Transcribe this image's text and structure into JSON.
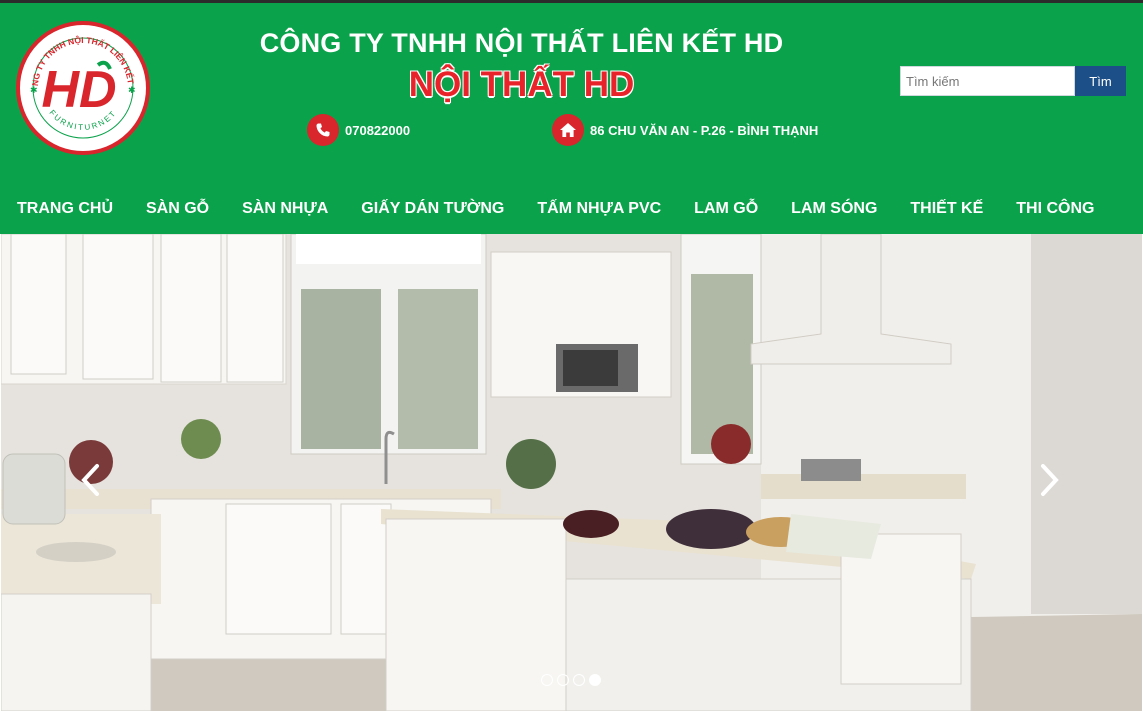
{
  "header": {
    "company_name": "CÔNG TY TNHH NỘI THẤT LIÊN KẾT HD",
    "brand_name": "NỘI THẤT HD",
    "phone": "070822000",
    "address": "86 CHU VĂN AN - P.26 - BÌNH THẠNH",
    "logo": {
      "initials": "HD",
      "ring_text_top": "CÔNG TY TNHH NỘI THẤT LIÊN KẾT HD",
      "ring_text_bottom": "FURNITURNET"
    }
  },
  "search": {
    "placeholder": "Tìm kiếm",
    "button_label": "Tìm"
  },
  "nav": {
    "items": [
      {
        "label": "TRANG CHỦ"
      },
      {
        "label": "SÀN GỖ"
      },
      {
        "label": "SÀN NHỰA"
      },
      {
        "label": "GIẤY DÁN TƯỜNG"
      },
      {
        "label": "TẤM NHỰA PVC"
      },
      {
        "label": "LAM GỖ"
      },
      {
        "label": "LAM SÓNG"
      },
      {
        "label": "THIẾT KẾ"
      },
      {
        "label": "THI CÔNG"
      }
    ]
  },
  "slider": {
    "slide_count": 4,
    "active_slide": 4
  },
  "colors": {
    "header_green": "#0aa24a",
    "accent_red": "#d9252c",
    "search_button": "#1c4f87"
  },
  "icons": [
    "phone-icon",
    "home-icon",
    "chevron-left-icon",
    "chevron-right-icon"
  ]
}
